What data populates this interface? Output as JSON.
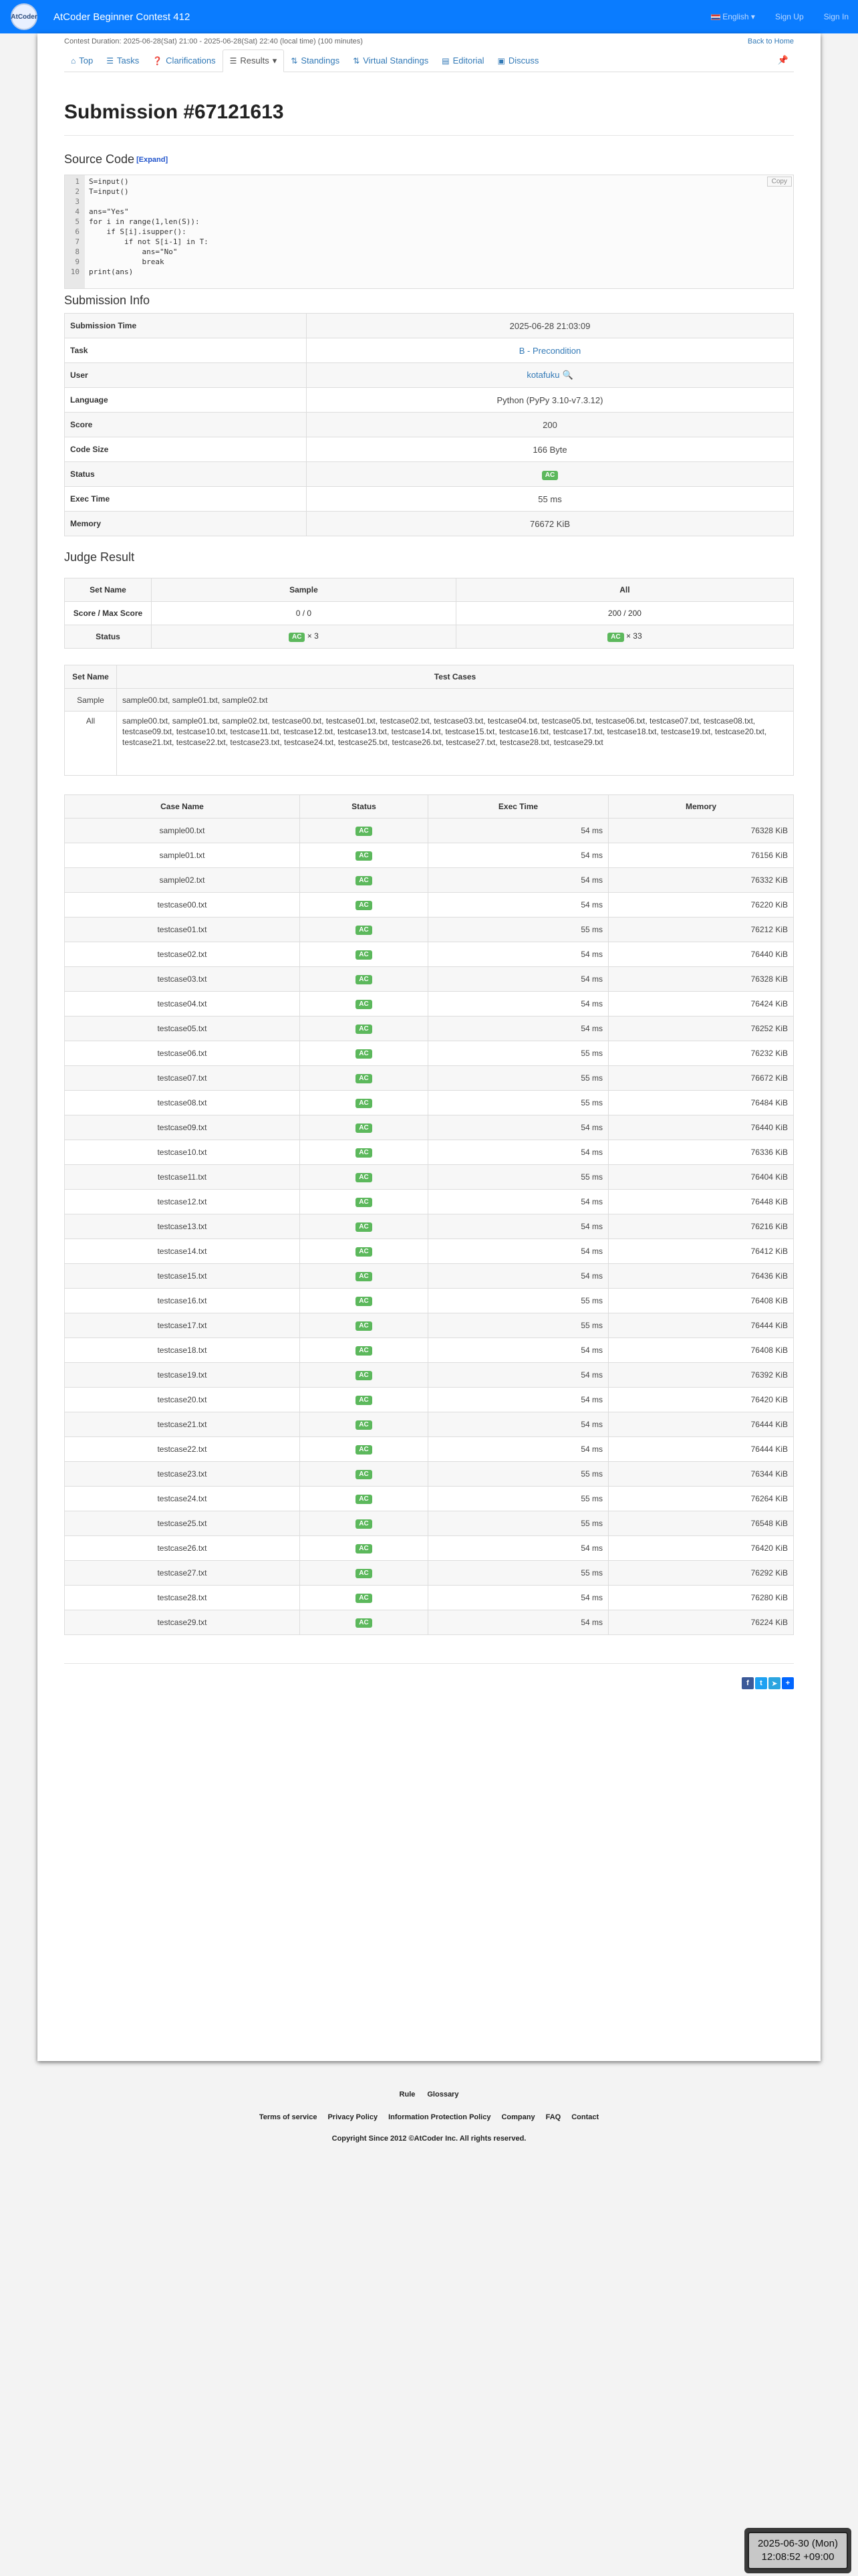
{
  "header": {
    "logo_text": "AtCoder",
    "contest_title": "AtCoder Beginner Contest 412",
    "language": "English",
    "sign_up": "Sign Up",
    "sign_in": "Sign In"
  },
  "contest": {
    "duration": "Contest Duration: 2025-06-28(Sat) 21:00 - 2025-06-28(Sat) 22:40 (local time) (100 minutes)",
    "back_home": "Back to Home"
  },
  "tabs": [
    {
      "label": "Top",
      "icon": "home-icon"
    },
    {
      "label": "Tasks",
      "icon": "list-icon"
    },
    {
      "label": "Clarifications",
      "icon": "question-icon"
    },
    {
      "label": "Results",
      "icon": "list-icon"
    },
    {
      "label": "Standings",
      "icon": "sort-icon"
    },
    {
      "label": "Virtual Standings",
      "icon": "sort-icon"
    },
    {
      "label": "Editorial",
      "icon": "book-icon"
    },
    {
      "label": "Discuss",
      "icon": "comment-icon"
    }
  ],
  "title": "Submission #67121613",
  "source": {
    "heading": "Source Code",
    "expand": "[Expand]",
    "copy": "Copy",
    "lines": [
      "S=input()",
      "T=input()",
      "",
      "ans=\"Yes\"",
      "for i in range(1,len(S)):",
      "    if S[i].isupper():",
      "        if not S[i-1] in T:",
      "            ans=\"No\"",
      "            break",
      "print(ans)"
    ]
  },
  "info": {
    "heading": "Submission Info",
    "rows": [
      {
        "label": "Submission Time",
        "value": "2025-06-28 21:03:09"
      },
      {
        "label": "Task",
        "value": "B - Precondition"
      },
      {
        "label": "User",
        "value": "kotafuku"
      },
      {
        "label": "Language",
        "value": "Python (PyPy 3.10-v7.3.12)"
      },
      {
        "label": "Score",
        "value": "200"
      },
      {
        "label": "Code Size",
        "value": "166 Byte"
      },
      {
        "label": "Status",
        "value": "AC"
      },
      {
        "label": "Exec Time",
        "value": "55 ms"
      },
      {
        "label": "Memory",
        "value": "76672 KiB"
      }
    ]
  },
  "judge": {
    "heading": "Judge Result",
    "col_set": "Set Name",
    "col_sample": "Sample",
    "col_all": "All",
    "row_score": "Score / Max Score",
    "score_sample": "0 / 0",
    "score_all": "200 / 200",
    "row_status": "Status",
    "status_badge": "AC",
    "status_sample_count": "× 3",
    "status_all_count": "× 33"
  },
  "sets": {
    "col_set": "Set Name",
    "col_cases": "Test Cases",
    "sample_name": "Sample",
    "sample_cases": "sample00.txt, sample01.txt, sample02.txt",
    "all_name": "All",
    "all_cases": "sample00.txt, sample01.txt, sample02.txt, testcase00.txt, testcase01.txt, testcase02.txt, testcase03.txt, testcase04.txt, testcase05.txt, testcase06.txt, testcase07.txt, testcase08.txt, testcase09.txt, testcase10.txt, testcase11.txt, testcase12.txt, testcase13.txt, testcase14.txt, testcase15.txt, testcase16.txt, testcase17.txt, testcase18.txt, testcase19.txt, testcase20.txt, testcase21.txt, testcase22.txt, testcase23.txt, testcase24.txt, testcase25.txt, testcase26.txt, testcase27.txt, testcase28.txt, testcase29.txt"
  },
  "cases": {
    "headers": [
      "Case Name",
      "Status",
      "Exec Time",
      "Memory"
    ],
    "rows": [
      [
        "sample00.txt",
        "AC",
        "54 ms",
        "76328 KiB"
      ],
      [
        "sample01.txt",
        "AC",
        "54 ms",
        "76156 KiB"
      ],
      [
        "sample02.txt",
        "AC",
        "54 ms",
        "76332 KiB"
      ],
      [
        "testcase00.txt",
        "AC",
        "54 ms",
        "76220 KiB"
      ],
      [
        "testcase01.txt",
        "AC",
        "55 ms",
        "76212 KiB"
      ],
      [
        "testcase02.txt",
        "AC",
        "54 ms",
        "76440 KiB"
      ],
      [
        "testcase03.txt",
        "AC",
        "54 ms",
        "76328 KiB"
      ],
      [
        "testcase04.txt",
        "AC",
        "54 ms",
        "76424 KiB"
      ],
      [
        "testcase05.txt",
        "AC",
        "54 ms",
        "76252 KiB"
      ],
      [
        "testcase06.txt",
        "AC",
        "55 ms",
        "76232 KiB"
      ],
      [
        "testcase07.txt",
        "AC",
        "55 ms",
        "76672 KiB"
      ],
      [
        "testcase08.txt",
        "AC",
        "55 ms",
        "76484 KiB"
      ],
      [
        "testcase09.txt",
        "AC",
        "54 ms",
        "76440 KiB"
      ],
      [
        "testcase10.txt",
        "AC",
        "54 ms",
        "76336 KiB"
      ],
      [
        "testcase11.txt",
        "AC",
        "55 ms",
        "76404 KiB"
      ],
      [
        "testcase12.txt",
        "AC",
        "54 ms",
        "76448 KiB"
      ],
      [
        "testcase13.txt",
        "AC",
        "54 ms",
        "76216 KiB"
      ],
      [
        "testcase14.txt",
        "AC",
        "54 ms",
        "76412 KiB"
      ],
      [
        "testcase15.txt",
        "AC",
        "54 ms",
        "76436 KiB"
      ],
      [
        "testcase16.txt",
        "AC",
        "55 ms",
        "76408 KiB"
      ],
      [
        "testcase17.txt",
        "AC",
        "55 ms",
        "76444 KiB"
      ],
      [
        "testcase18.txt",
        "AC",
        "54 ms",
        "76408 KiB"
      ],
      [
        "testcase19.txt",
        "AC",
        "54 ms",
        "76392 KiB"
      ],
      [
        "testcase20.txt",
        "AC",
        "54 ms",
        "76420 KiB"
      ],
      [
        "testcase21.txt",
        "AC",
        "54 ms",
        "76444 KiB"
      ],
      [
        "testcase22.txt",
        "AC",
        "54 ms",
        "76444 KiB"
      ],
      [
        "testcase23.txt",
        "AC",
        "55 ms",
        "76344 KiB"
      ],
      [
        "testcase24.txt",
        "AC",
        "55 ms",
        "76264 KiB"
      ],
      [
        "testcase25.txt",
        "AC",
        "55 ms",
        "76548 KiB"
      ],
      [
        "testcase26.txt",
        "AC",
        "54 ms",
        "76420 KiB"
      ],
      [
        "testcase27.txt",
        "AC",
        "55 ms",
        "76292 KiB"
      ],
      [
        "testcase28.txt",
        "AC",
        "54 ms",
        "76280 KiB"
      ],
      [
        "testcase29.txt",
        "AC",
        "54 ms",
        "76224 KiB"
      ]
    ]
  },
  "footer": {
    "rule": "Rule",
    "glossary": "Glossary",
    "links": [
      "Terms of service",
      "Privacy Policy",
      "Information Protection Policy",
      "Company",
      "FAQ",
      "Contact"
    ],
    "copyright": "Copyright Since 2012 ©AtCoder Inc. All rights reserved."
  },
  "clock": {
    "date": "2025-06-30 (Mon)",
    "time": "12:08:52 +09:00"
  },
  "colors": {
    "navbar": "#0a7cff",
    "link": "#337ab7",
    "ac_badge": "#5cb85c"
  }
}
